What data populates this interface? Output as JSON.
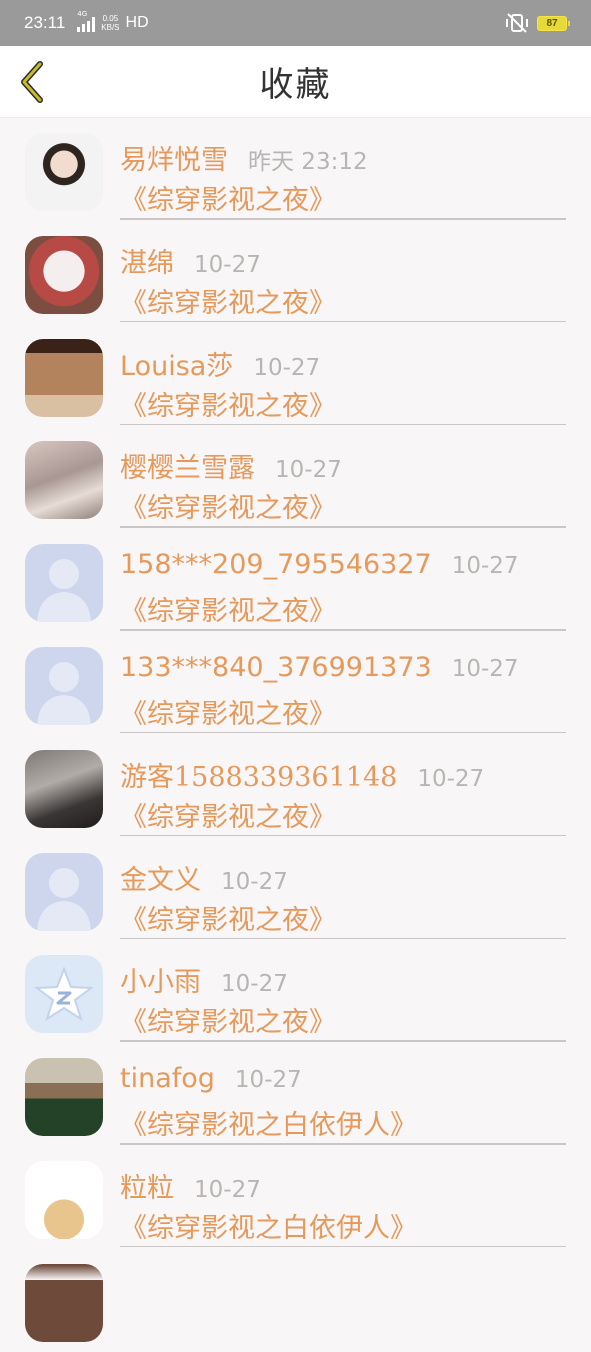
{
  "status_bar": {
    "time": "23:11",
    "network_type": "4G",
    "speed_value": "0.05",
    "speed_unit": "KB/S",
    "hd": "HD",
    "battery": "87",
    "battery_color": "#e7d93a"
  },
  "nav": {
    "title": "收藏",
    "back_icon": "chevron-left-icon"
  },
  "colors": {
    "accent": "#e59a5c",
    "time_gray": "#b9b5b3",
    "back_icon": "#c9ba2a"
  },
  "items": [
    {
      "name": "易烊悦雪",
      "time": "昨天 23:12",
      "book": "《综穿影视之夜》",
      "avatar": "photo"
    },
    {
      "name": "湛绵",
      "time": "10-27",
      "book": "《综穿影视之夜》",
      "avatar": "photo"
    },
    {
      "name": "Louisa莎",
      "time": "10-27",
      "book": "《综穿影视之夜》",
      "avatar": "photo"
    },
    {
      "name": "樱樱兰雪露",
      "time": "10-27",
      "book": "《综穿影视之夜》",
      "avatar": "photo"
    },
    {
      "name": "158***209_795546327",
      "time": "10-27",
      "book": "《综穿影视之夜》",
      "avatar": "default-user-icon"
    },
    {
      "name": "133***840_376991373",
      "time": "10-27",
      "book": "《综穿影视之夜》",
      "avatar": "default-user-icon"
    },
    {
      "name": "游客1588339361148",
      "time": "10-27",
      "book": "《综穿影视之夜》",
      "avatar": "photo"
    },
    {
      "name": "金文义",
      "time": "10-27",
      "book": "《综穿影视之夜》",
      "avatar": "default-user-icon"
    },
    {
      "name": "小小雨",
      "time": "10-27",
      "book": "《综穿影视之夜》",
      "avatar": "qq-star-icon"
    },
    {
      "name": "tinafog",
      "time": "10-27",
      "book": "《综穿影视之白依伊人》",
      "avatar": "photo"
    },
    {
      "name": "粒粒",
      "time": "10-27",
      "book": "《综穿影视之白依伊人》",
      "avatar": "photo"
    }
  ]
}
